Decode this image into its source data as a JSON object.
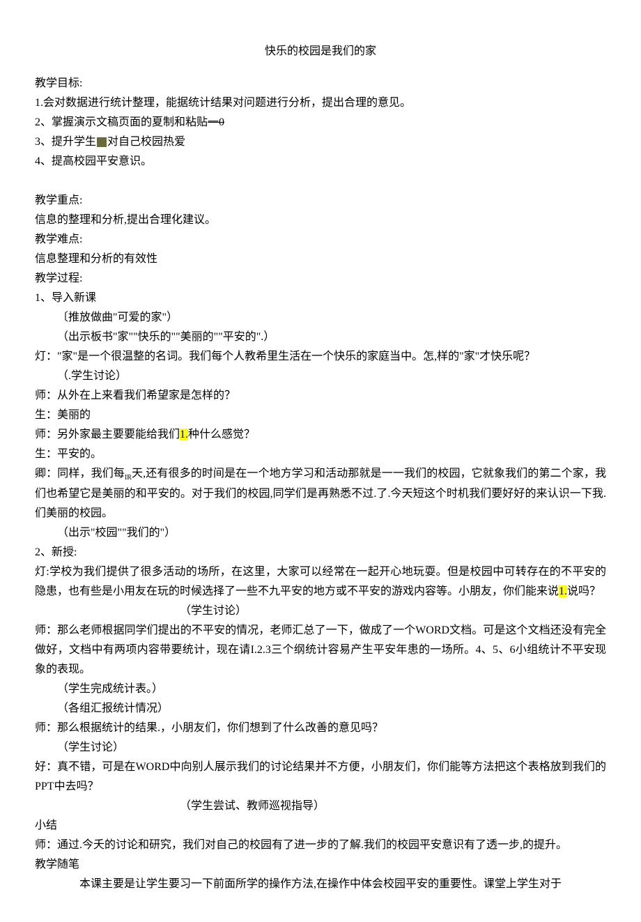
{
  "title": "快乐的校园是我们的家",
  "lines": {
    "a1": "教学目标:",
    "a2": "1.会对数据进行统计整理，能据统计结果对问题进行分析，提出合理的意见。",
    "a3a": "2、掌握演示文稿页面的夏制和粘贴",
    "a3b": "一0",
    "a4a": "3、提升学生",
    "a4b": "对自己校园热爱",
    "a5": "4、提高校园平安意识。",
    "b1": "教学重点:",
    "b2": "信息的整理和分析,提出合理化建议。",
    "b3": "教学难点:",
    "b4": "信息整理和分析的有效性",
    "b5": "教学过程:",
    "b6": "1、导入新课",
    "b7": "〔推放做曲\"可爱的家\"）",
    "b8": "（出示板书\"家\"\"快乐的\"\"美丽的\"\"平安的\".）",
    "b9": "灯：\"家\"是一个很温整的名词。我们每个人教希里生活在一个快乐的家庭当中。怎,样的\"家\"才快乐呢？",
    "b10": "（.学生讨论）",
    "b11": "师：从外在上来看我们希望家是怎样的？",
    "b12": "生：美丽的",
    "b13a": "师：另外家最主要要能给我们",
    "b13hl": "1.",
    "b13b": "种什么感觉？",
    "b14": "生：平安的。",
    "b15a": "卿：同样，我们每",
    "b15sub": "IR",
    "b15b": "天,还有很多的时间是在一个地方学习和活动那就是一一我们的校园，它就象我们的第二个家，我们也希望它是美丽的和平安的。对于我们的校园,同学们是再熟悉不过.了.今天短这个时机我们要好好的来认识一下我.们美丽的校园。",
    "b16": "（出示\"校园\"\"我们的\"）",
    "c1": "2、新授:",
    "c2a": "灯:学校为我们提供了很多活动的场所，在这里，大家可以经常在一起开心地玩耍。但是校园中可转存在的不平安的隐患，也有些是小用友在玩的时候选择了一些不九平安的地方或不平安的游戏内容等。小朋友，你们能来说",
    "c2hl": "1.",
    "c2b": "说吗？",
    "c3": "（学生讨论）",
    "c4": "师：那么老师根据同学们提出的不平安的情况，老师汇总了一下，做成了一个WORD文档。可是这个文档还没有完全做好，文档中有两项内容带要统计，现在请I.2.3三个纲统计容易产生平安年患的一场所。4、5、6小组统计不平安现象的表现。",
    "c5": "（学生完成统计表。）",
    "c6": "（各组汇报统计情况）",
    "c7": "师：那么根据统计的结果.，小朋友们，你们想到了什么改善的意见吗？",
    "c8": "（学生讨论）",
    "c9": "好：真不错，可是在WORD中向别人展示我们的讨论结果并不方便，小朋友们，你们能等方法把这个表格放到我们的PPT中去吗？",
    "c10": "（学生尝试、教师巡视指导）",
    "d1": "小结",
    "d2": "师：通过.今夭的讨论和研究，我们对自己的校园有了进一步的了解.我们的校园平安意识有了透一步,的提升。",
    "d3": "教学随笔",
    "d4": "本课主要是让学生要习一下前面所学的操作方法,在操作中体会校园平安的重要性。课堂上学生对于"
  }
}
